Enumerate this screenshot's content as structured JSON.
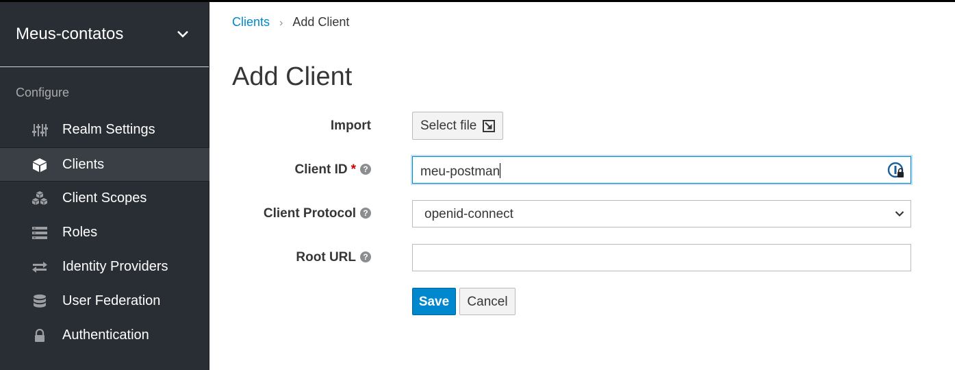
{
  "sidebar": {
    "realm_name": "Meus-contatos",
    "section_label": "Configure",
    "items": [
      {
        "label": "Realm Settings",
        "icon": "sliders-icon",
        "active": false
      },
      {
        "label": "Clients",
        "icon": "cube-icon",
        "active": true
      },
      {
        "label": "Client Scopes",
        "icon": "cubes-icon",
        "active": false
      },
      {
        "label": "Roles",
        "icon": "list-icon",
        "active": false
      },
      {
        "label": "Identity Providers",
        "icon": "exchange-icon",
        "active": false
      },
      {
        "label": "User Federation",
        "icon": "database-icon",
        "active": false
      },
      {
        "label": "Authentication",
        "icon": "lock-icon",
        "active": false
      }
    ]
  },
  "breadcrumb": {
    "parent": "Clients",
    "current": "Add Client"
  },
  "page_title": "Add Client",
  "form": {
    "import_label": "Import",
    "select_file_label": "Select file",
    "client_id_label": "Client ID",
    "required_marker": "*",
    "client_id_value": "meu-postman",
    "client_protocol_label": "Client Protocol",
    "client_protocol_value": "openid-connect",
    "root_url_label": "Root URL",
    "root_url_value": "",
    "help_glyph": "?"
  },
  "actions": {
    "save_label": "Save",
    "cancel_label": "Cancel"
  },
  "colors": {
    "sidebar_bg": "#292e34",
    "active_item_bg": "#393f44",
    "accent": "#0088ce",
    "required": "#cc0000"
  }
}
